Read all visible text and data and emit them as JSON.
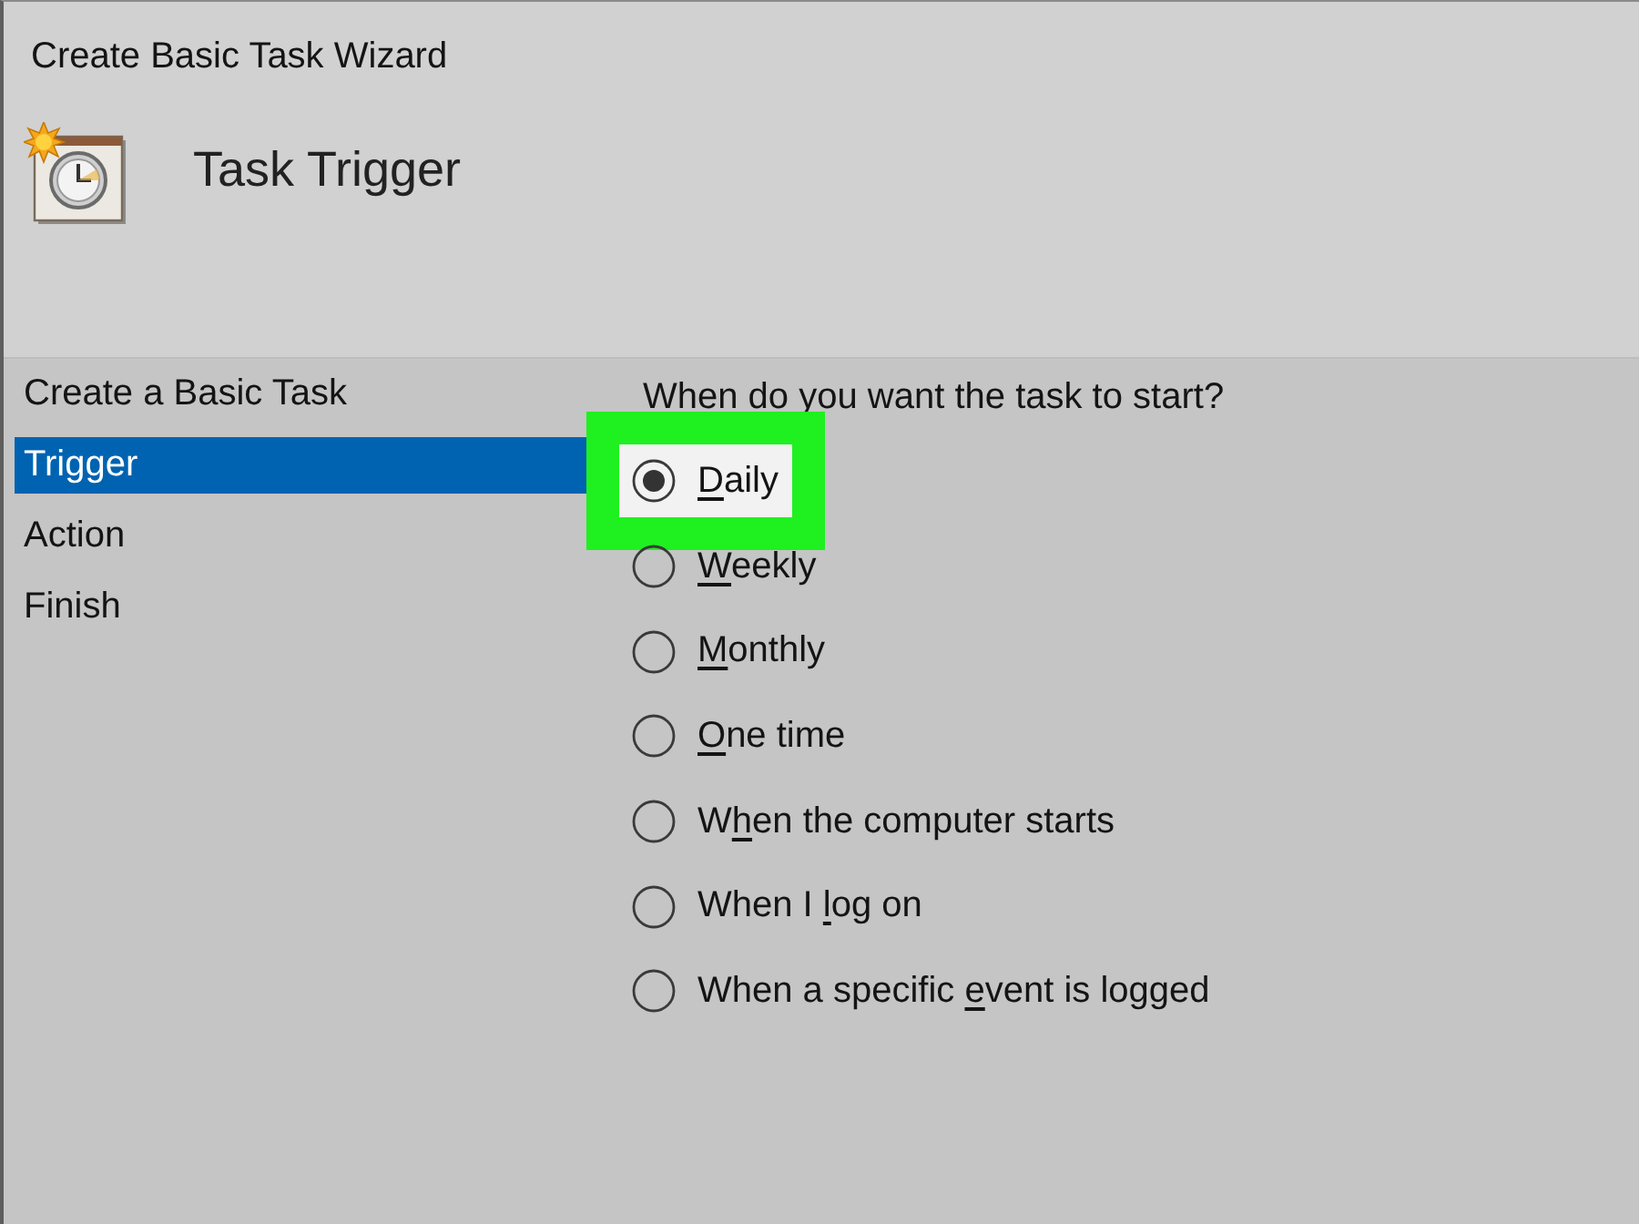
{
  "window": {
    "title": "Create Basic Task Wizard"
  },
  "header": {
    "title": "Task Trigger"
  },
  "steps": [
    {
      "label": "Create a Basic Task",
      "selected": false
    },
    {
      "label": "Trigger",
      "selected": true
    },
    {
      "label": "Action",
      "selected": false
    },
    {
      "label": "Finish",
      "selected": false
    }
  ],
  "question": "When do you want the task to start?",
  "options": [
    {
      "access_key": "D",
      "text_after": "aily",
      "selected": true,
      "highlighted": true
    },
    {
      "access_key": "W",
      "text_after": "eekly",
      "selected": false,
      "highlighted": false
    },
    {
      "access_key": "M",
      "text_after": "onthly",
      "selected": false,
      "highlighted": false
    },
    {
      "access_key": "O",
      "text_after": "ne time",
      "selected": false,
      "highlighted": false
    },
    {
      "text_before": "W",
      "access_key": "h",
      "text_after": "en the computer starts",
      "selected": false,
      "highlighted": false
    },
    {
      "text_before": "When I ",
      "access_key": "l",
      "text_after": "og on",
      "selected": false,
      "highlighted": false
    },
    {
      "text_before": "When a specific ",
      "access_key": "e",
      "text_after": "vent is logged",
      "selected": false,
      "highlighted": false
    }
  ]
}
